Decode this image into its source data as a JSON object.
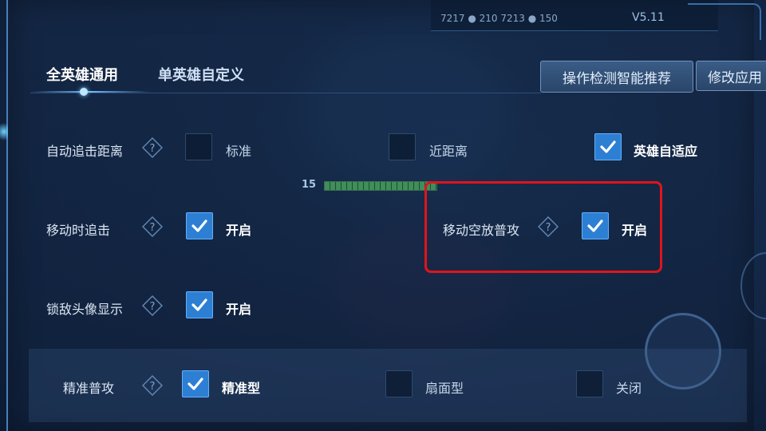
{
  "top_bar": {
    "stats": "7217  ● 210  7213  ● 150",
    "version": "V5.11"
  },
  "tabs": [
    {
      "label": "全英雄通用",
      "active": true
    },
    {
      "label": "单英雄自定义",
      "active": false
    }
  ],
  "buttons": {
    "recommend": "操作检测智能推荐",
    "apply": "修改应用"
  },
  "hud": {
    "level": "15"
  },
  "settings": {
    "auto_chase": {
      "label": "自动追击距离",
      "options": [
        {
          "label": "标准",
          "checked": false
        },
        {
          "label": "近距离",
          "checked": false
        },
        {
          "label": "英雄自适应",
          "checked": true
        }
      ]
    },
    "move_chase": {
      "label": "移动时追击",
      "option": "开启",
      "checked": true
    },
    "move_attack": {
      "label": "移动空放普攻",
      "option": "开启",
      "checked": true
    },
    "lock_avatar": {
      "label": "锁敌头像显示",
      "option": "开启",
      "checked": true
    },
    "precise_attack": {
      "label": "精准普攻",
      "options": [
        {
          "label": "精准型",
          "checked": true
        },
        {
          "label": "扇面型",
          "checked": false
        },
        {
          "label": "关闭",
          "checked": false
        }
      ]
    }
  },
  "colors": {
    "accent": "#2d7fd3",
    "highlight": "#e0141c"
  }
}
